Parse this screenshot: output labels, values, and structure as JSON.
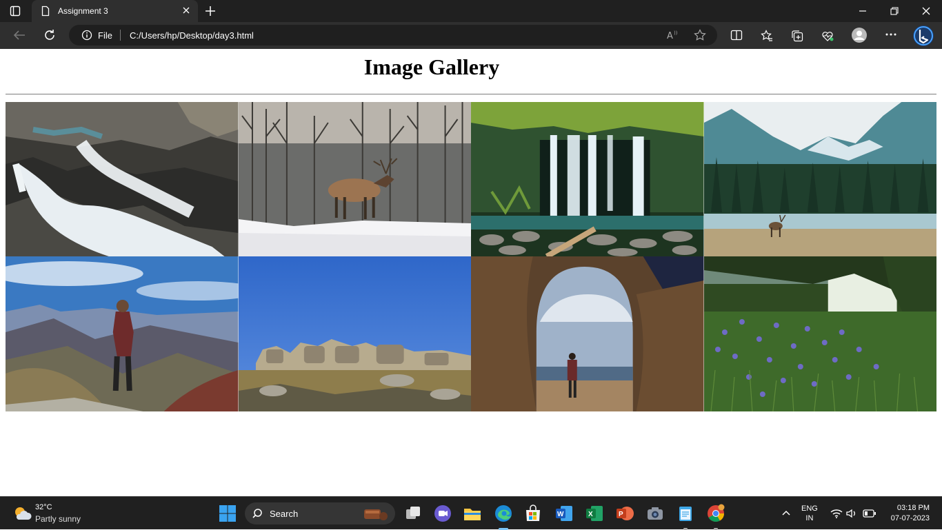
{
  "browser": {
    "tab_title": "Assignment 3",
    "address_scheme_label": "File",
    "url": "C:/Users/hp/Desktop/day3.html"
  },
  "page": {
    "heading": "Image Gallery",
    "images": [
      {
        "subject": "rocky waterfall stream"
      },
      {
        "subject": "elk in snowy forest"
      },
      {
        "subject": "jungle waterfall"
      },
      {
        "subject": "elk by mountain river"
      },
      {
        "subject": "hiker on mountain ridge"
      },
      {
        "subject": "rocks under blue sky"
      },
      {
        "subject": "person in cave arch"
      },
      {
        "subject": "wildflower meadow"
      }
    ]
  },
  "taskbar": {
    "weather_temp": "32°C",
    "weather_desc": "Partly sunny",
    "search_label": "Search",
    "lang_1": "ENG",
    "lang_2": "IN",
    "time": "03:18 PM",
    "date": "07-07-2023"
  }
}
